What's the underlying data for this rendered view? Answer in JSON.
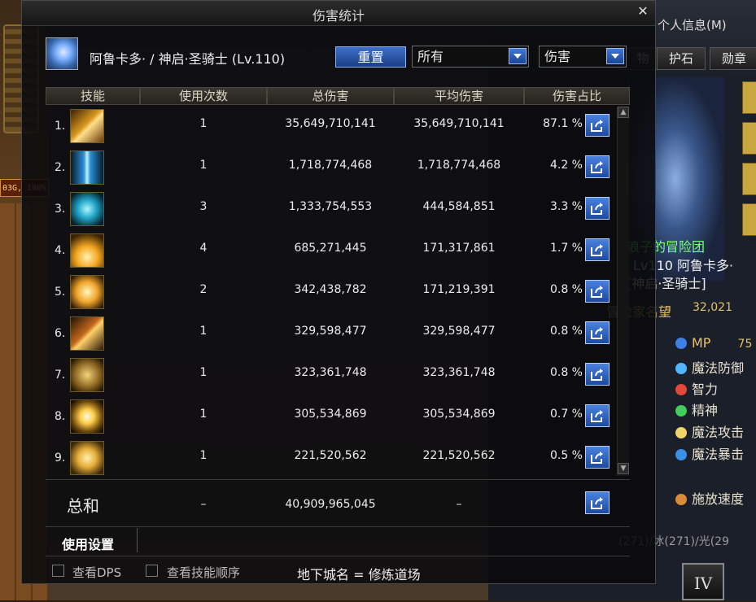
{
  "window": {
    "title": "伤害统计"
  },
  "character": {
    "name": "阿鲁卡多· / 神启·圣骑士 (Lv.110)"
  },
  "controls": {
    "reset_label": "重置",
    "filter_all": "所有",
    "filter_type": "伤害"
  },
  "table": {
    "headers": [
      "技能",
      "使用次数",
      "总伤害",
      "平均伤害",
      "伤害占比"
    ],
    "rows": [
      {
        "num": "1.",
        "icon": "lightning-slash-skill-icon",
        "count": "1",
        "total": "35,649,710,141",
        "avg": "35,649,710,141",
        "pct": "87.1 %"
      },
      {
        "num": "2.",
        "icon": "ice-pillar-skill-icon",
        "count": "1",
        "total": "1,718,774,468",
        "avg": "1,718,774,468",
        "pct": "4.2 %"
      },
      {
        "num": "3.",
        "icon": "cyan-beam-skill-icon",
        "count": "3",
        "total": "1,333,754,553",
        "avg": "444,584,851",
        "pct": "3.3 %"
      },
      {
        "num": "4.",
        "icon": "golden-burst-skill-icon",
        "count": "4",
        "total": "685,271,445",
        "avg": "171,317,861",
        "pct": "1.7 %"
      },
      {
        "num": "5.",
        "icon": "holy-cross-skill-icon",
        "count": "2",
        "total": "342,438,782",
        "avg": "171,219,391",
        "pct": "0.8 %"
      },
      {
        "num": "6.",
        "icon": "fire-strike-skill-icon",
        "count": "1",
        "total": "329,598,477",
        "avg": "329,598,477",
        "pct": "0.8 %"
      },
      {
        "num": "7.",
        "icon": "holy-rune-skill-icon",
        "count": "1",
        "total": "323,361,748",
        "avg": "323,361,748",
        "pct": "0.8 %"
      },
      {
        "num": "8.",
        "icon": "sun-burst-skill-icon",
        "count": "1",
        "total": "305,534,869",
        "avg": "305,534,869",
        "pct": "0.7 %"
      },
      {
        "num": "9.",
        "icon": "light-emblem-skill-icon",
        "count": "1",
        "total": "221,520,562",
        "avg": "221,520,562",
        "pct": "0.5 %"
      }
    ],
    "total": {
      "label": "总和",
      "count": "–",
      "total": "40,909,965,045",
      "avg": "–"
    }
  },
  "footer": {
    "settings_label": "使用设置",
    "dps_label": "查看DPS",
    "order_label": "查看技能顺序",
    "dungeon": "地下城名 = 修炼道场"
  },
  "background": {
    "left_tag": "03G, 100%",
    "tabs": [
      "物",
      "护石",
      "勋章"
    ],
    "header_info": "个人信息(M)",
    "guild": "浪子的冒险团",
    "name_line": "Lv110  阿鲁卡多·",
    "class_line": "[神启·圣骑士]",
    "fame_label": "冒险家名望",
    "fame_value": "32,021",
    "stats": [
      "MP",
      "魔法防御",
      "智力",
      "精神",
      "魔法攻击",
      "魔法暴击",
      "施放速度"
    ],
    "mp_value": "75",
    "element_line": "(271)/冰(271)/光(29"
  },
  "colors": {
    "accent": "#2f5fbf",
    "panel": "#0a0a0c",
    "text": "#ededed"
  }
}
